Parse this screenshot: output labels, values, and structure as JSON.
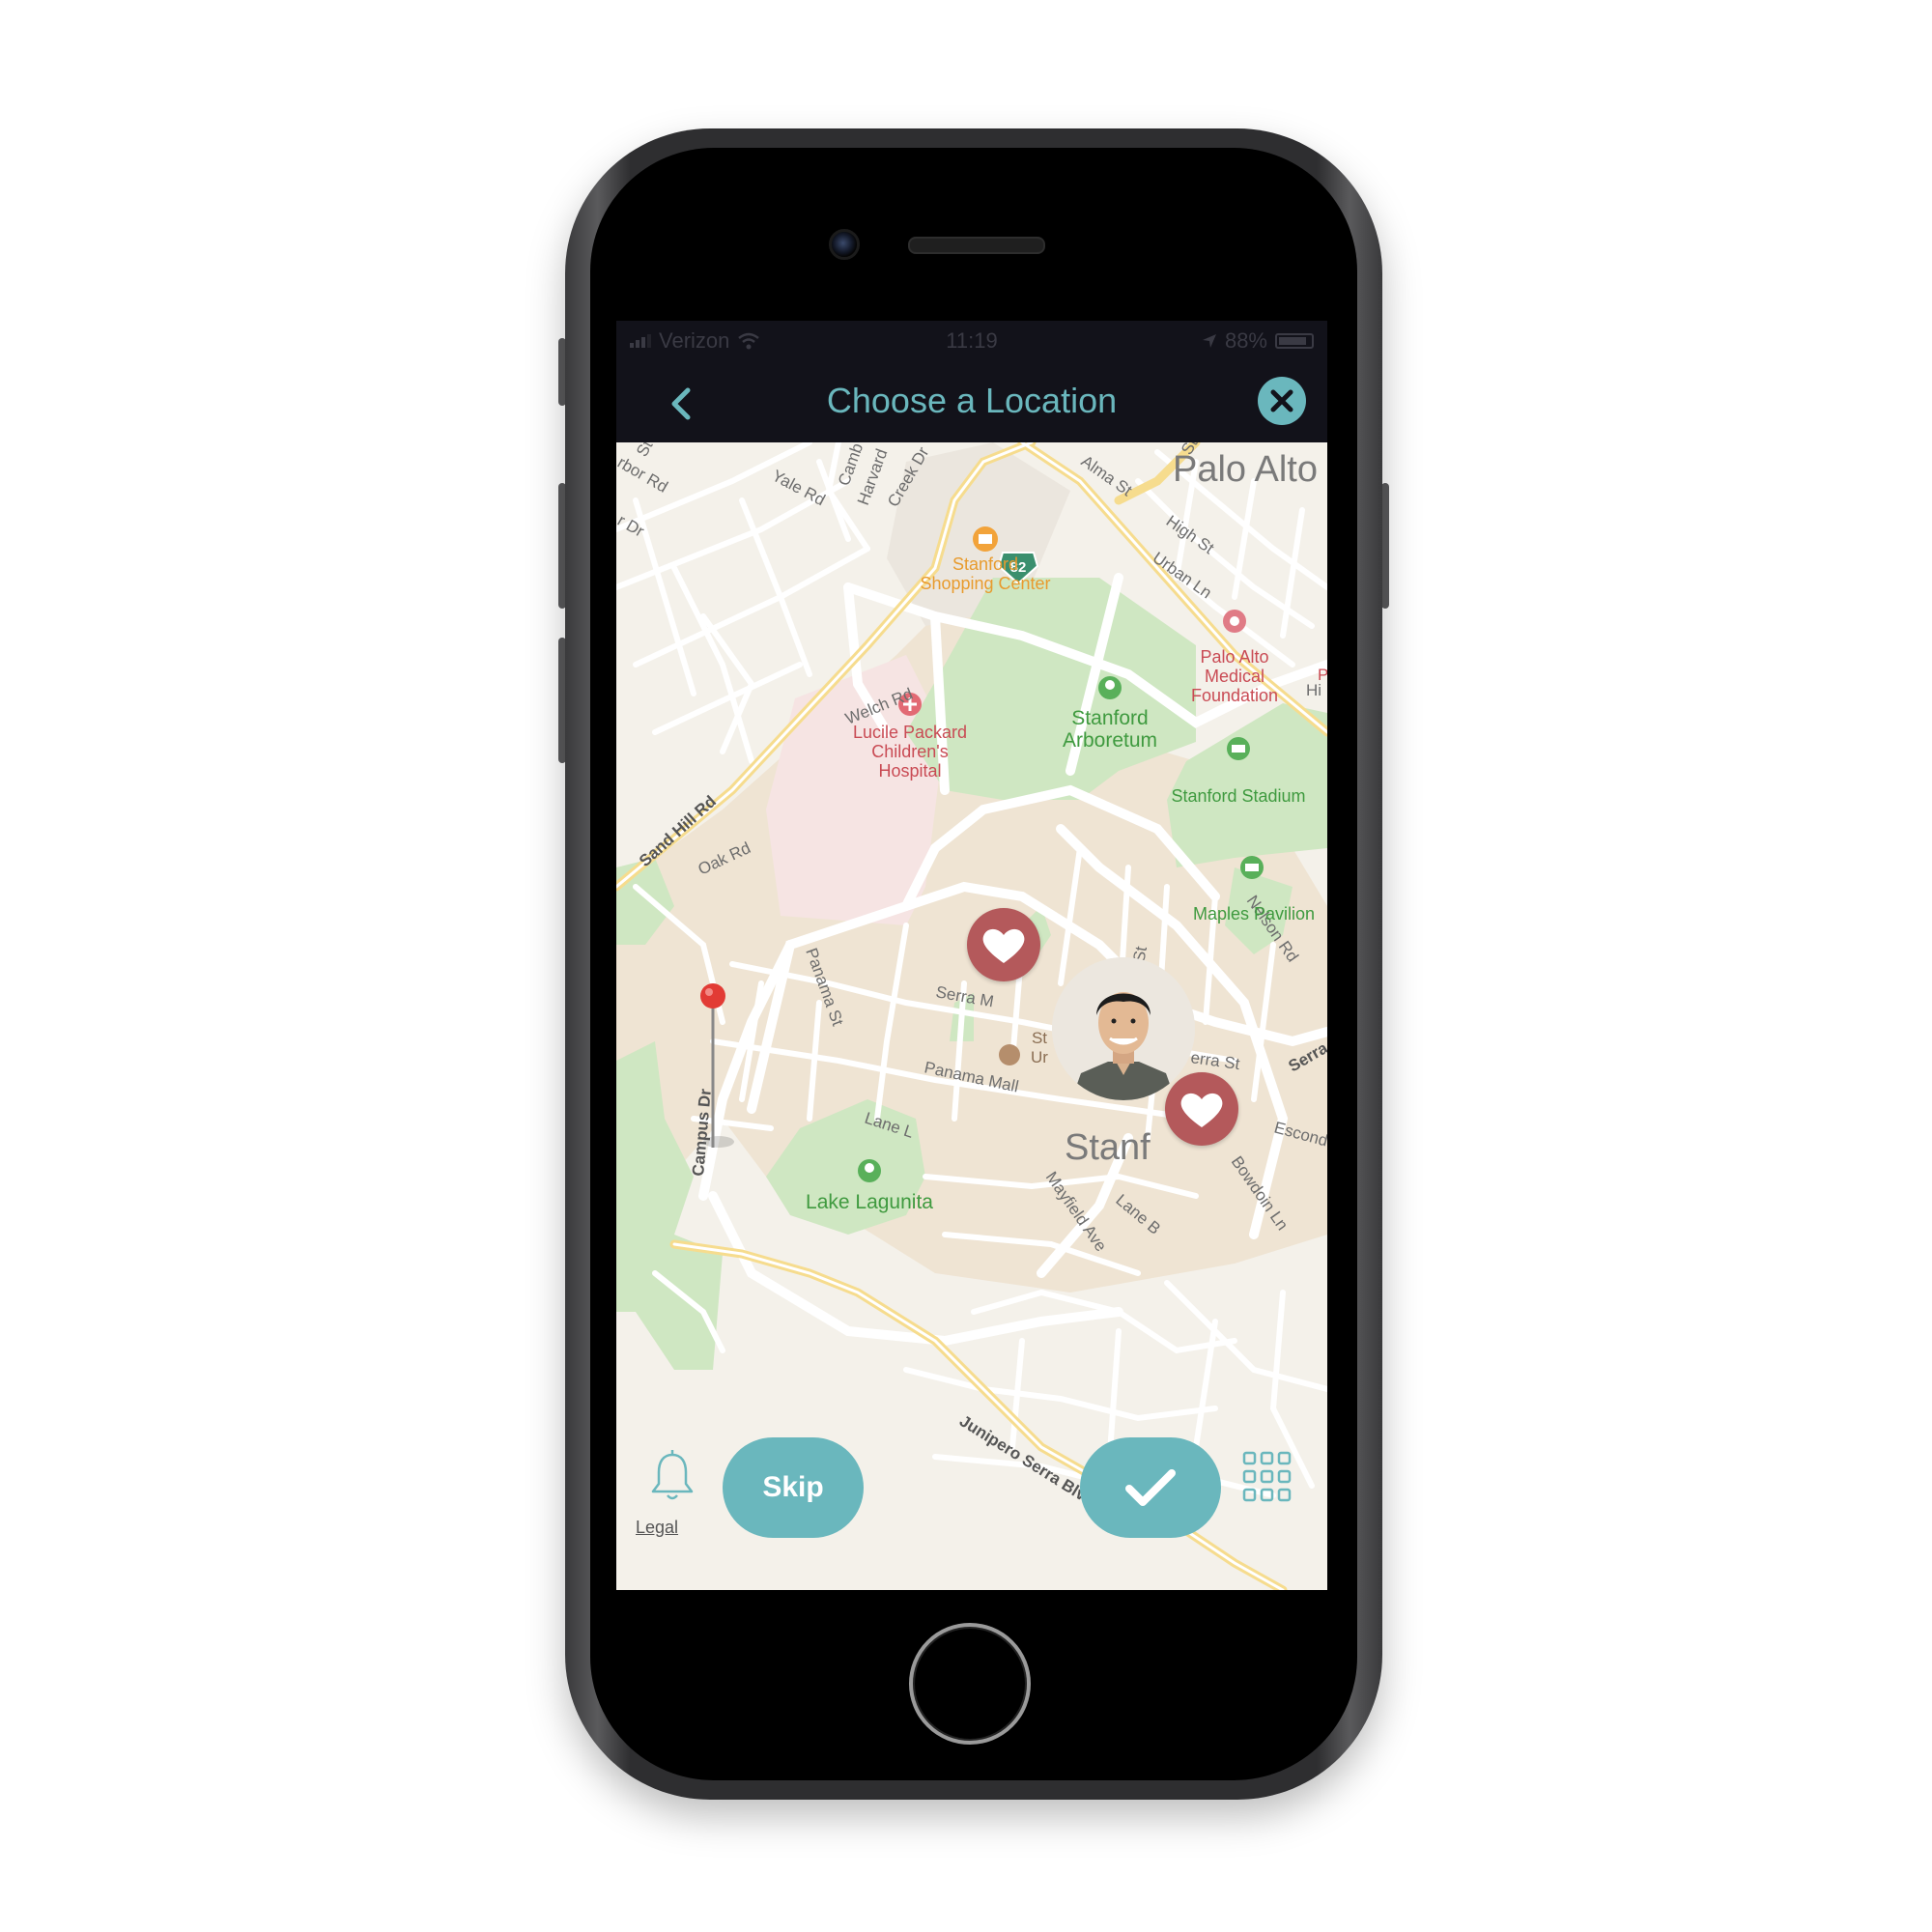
{
  "status_bar": {
    "carrier": "Verizon",
    "time": "11:19",
    "battery": "88%",
    "battery_level": 0.88
  },
  "nav": {
    "title": "Choose a Location",
    "back_icon": "chevron-left-icon",
    "close_icon": "close-icon"
  },
  "map": {
    "city_labels": [
      "Palo Alto",
      "Stanf"
    ],
    "street_labels": {
      "alma": "Alma St",
      "high": "High St",
      "urban": "Urban Ln",
      "yale": "Yale Rd",
      "welch": "Welch Rd",
      "sandhill": "Sand Hill Rd",
      "oak": "Oak Rd",
      "panama_st": "Panama St",
      "serra_m": "Serra M",
      "serra_st": "erra St",
      "serra_right": "Serra",
      "panama_mall": "Panama Mall",
      "lane_l": "Lane L",
      "campus": "Campus Dr",
      "mayfield": "Mayfield Ave",
      "lane_b": "Lane B",
      "bowdoin": "Bowdoin Ln",
      "escond": "Escond",
      "nelson": "Nelson Rd",
      "ivez": "Ivez St",
      "junipero": "Junipero Serra Blvd",
      "creek": "Creek Dr",
      "harvard": "Harvard",
      "camb": "Camb",
      "arbor": "rbor Rd",
      "r_dr": "r Dr",
      "hi": "Hi",
      "p": "P",
      "st_top": "St",
      "st_top2": "St"
    },
    "places": {
      "shopping_line1": "Stanford",
      "shopping_line2": "Shopping Center",
      "pamf_line1": "Palo Alto",
      "pamf_line2": "Medical",
      "pamf_line3": "Foundation",
      "arboretum_line1": "Stanford",
      "arboretum_line2": "Arboretum",
      "lucile_line1": "Lucile Packard",
      "lucile_line2": "Children's",
      "lucile_line3": "Hospital",
      "stadium": "Stanford Stadium",
      "maples": "Maples Pavilion",
      "lagunita": "Lake Lagunita",
      "su_line1": "St",
      "su_line2": "Ur"
    },
    "highway_shield": "82",
    "colors": {
      "land": "#f4f1ea",
      "campus": "#efe4d3",
      "park": "#cfe7c2",
      "hospital": "#f6e4e3",
      "road": "#ffffff",
      "highway": "#f6dc8e",
      "park_text": "#3f9a3f",
      "medical_text": "#c94b54",
      "shop_text": "#e89b2e"
    }
  },
  "markers": {
    "heart_icon": "heart-icon",
    "pin_icon": "map-pin-icon",
    "avatar_icon": "user-avatar"
  },
  "bottom": {
    "skip_label": "Skip",
    "legal_label": "Legal",
    "bell_icon": "bell-icon",
    "confirm_icon": "checkmark-icon",
    "grid_icon": "grid-icon"
  },
  "accent_color": "#6ab7bd",
  "heart_color": "#b4595b"
}
